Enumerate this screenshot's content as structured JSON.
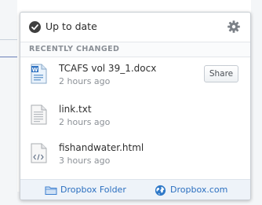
{
  "status": {
    "text": "Up to date"
  },
  "section": {
    "title": "RECENTLY CHANGED"
  },
  "files": [
    {
      "name": "TCAFS vol 39_1.docx",
      "time": "2 hours ago",
      "icon": "word-doc-icon",
      "action": "Share"
    },
    {
      "name": "link.txt",
      "time": "2 hours ago",
      "icon": "text-file-icon"
    },
    {
      "name": "fishandwater.html",
      "time": "3 hours ago",
      "icon": "html-file-icon"
    }
  ],
  "footer": {
    "folder_label": "Dropbox Folder",
    "site_label": "Dropbox.com"
  },
  "colors": {
    "link": "#2b6fc0",
    "folder_icon": "#3d7fd0",
    "globe_icon": "#2f79c8"
  }
}
